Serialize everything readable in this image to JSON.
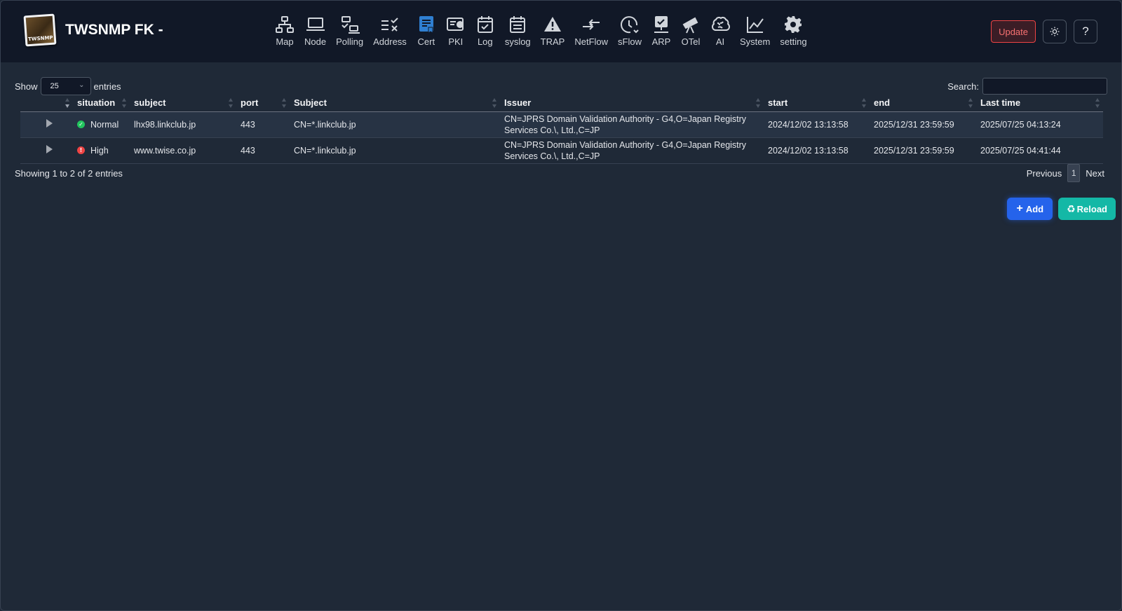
{
  "app": {
    "title": "TWSNMP FK -",
    "logo_text": "TWSNMP"
  },
  "menu": [
    {
      "label": "Map",
      "icon": "network-map-icon"
    },
    {
      "label": "Node",
      "icon": "laptop-icon"
    },
    {
      "label": "Polling",
      "icon": "polling-icon"
    },
    {
      "label": "Address",
      "icon": "address-list-icon"
    },
    {
      "label": "Cert",
      "icon": "certificate-icon",
      "active": true
    },
    {
      "label": "PKI",
      "icon": "pki-badge-icon"
    },
    {
      "label": "Log",
      "icon": "calendar-check-icon"
    },
    {
      "label": "syslog",
      "icon": "calendar-list-icon"
    },
    {
      "label": "TRAP",
      "icon": "warning-triangle-icon"
    },
    {
      "label": "NetFlow",
      "icon": "arrows-exchange-icon"
    },
    {
      "label": "sFlow",
      "icon": "clock-icon"
    },
    {
      "label": "ARP",
      "icon": "monitor-check-icon"
    },
    {
      "label": "OTel",
      "icon": "telescope-icon"
    },
    {
      "label": "AI",
      "icon": "brain-icon"
    },
    {
      "label": "System",
      "icon": "line-chart-icon"
    },
    {
      "label": "setting",
      "icon": "gear-icon"
    }
  ],
  "header_right": {
    "update_label": "Update",
    "theme_icon": "sun-icon",
    "help_label": "?"
  },
  "table_controls": {
    "show_label": "Show",
    "page_length": "25",
    "entries_label": "entries",
    "search_label": "Search:",
    "search_value": ""
  },
  "table": {
    "columns": [
      "situation",
      "subject",
      "port",
      "Subject",
      "Issuer",
      "start",
      "end",
      "Last time"
    ],
    "rows": [
      {
        "situation": "Normal",
        "status": "ok",
        "subject": "lhx98.linkclub.jp",
        "port": "443",
        "Subject": "CN=*.linkclub.jp",
        "Issuer": "CN=JPRS Domain Validation Authority - G4,O=Japan Registry Services Co.\\, Ltd.,C=JP",
        "start": "2024/12/02 13:13:58",
        "end": "2025/12/31 23:59:59",
        "last_time": "2025/07/25 04:13:24"
      },
      {
        "situation": "High",
        "status": "error",
        "subject": "www.twise.co.jp",
        "port": "443",
        "Subject": "CN=*.linkclub.jp",
        "Issuer": "CN=JPRS Domain Validation Authority - G4,O=Japan Registry Services Co.\\, Ltd.,C=JP",
        "start": "2024/12/02 13:13:58",
        "end": "2025/12/31 23:59:59",
        "last_time": "2025/07/25 04:41:44"
      }
    ]
  },
  "footer": {
    "info": "Showing 1 to 2 of 2 entries",
    "previous": "Previous",
    "page": "1",
    "next": "Next"
  },
  "actions": {
    "add_label": "Add",
    "reload_label": "Reload"
  },
  "colors": {
    "background": "#1f2937",
    "navbar": "#111827",
    "accent_active": "#2f7fd1",
    "update_border": "#ef4444",
    "add_button": "#2563eb",
    "reload_button": "#14b8a6",
    "status_ok": "#22c55e",
    "status_high": "#ef4444"
  }
}
